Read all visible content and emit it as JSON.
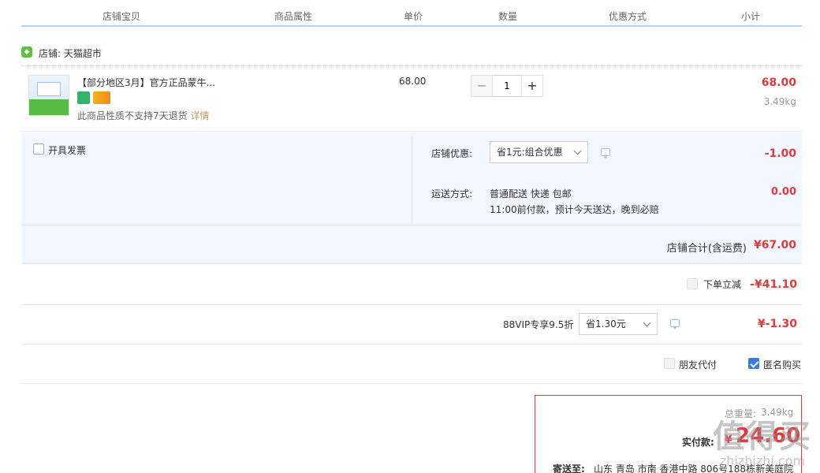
{
  "header": {
    "col_item": "店铺宝贝",
    "col_attr": "商品属性",
    "col_price": "单价",
    "col_qty": "数量",
    "col_discount": "优惠方式",
    "col_subtotal": "小计"
  },
  "shop": {
    "label": "店铺: 天猫超市"
  },
  "item": {
    "title": "【部分地区3月】官方正品蒙牛...",
    "note": "此商品性质不支持7天退货",
    "note_link": "详情",
    "unit_price": "68.00",
    "quantity": "1",
    "subtotal": "68.00",
    "weight": "3.49kg"
  },
  "invoice": {
    "label": "开具发票"
  },
  "shop_discount": {
    "label": "店铺优惠:",
    "selected": "省1元:组合优惠",
    "amount": "-1.00"
  },
  "shipping": {
    "label": "运送方式:",
    "method": "普通配送 快递 包邮",
    "eta": "11:00前付款，预计今天送达，晚到必赔",
    "amount": "0.00"
  },
  "shop_total": {
    "label": "店铺合计(含运费)",
    "amount": "¥67.00"
  },
  "instant_discount": {
    "label": "下单立减",
    "amount": "-¥41.10"
  },
  "vip": {
    "label": "88VIP专享9.5折",
    "selected": "省1.30元",
    "amount": "¥-1.30"
  },
  "options": {
    "friend_pay": "朋友代付",
    "anonymous": "匿名购买"
  },
  "summary": {
    "weight_label": "总重量:",
    "weight_value": "3.49kg",
    "pay_label": "实付款:",
    "currency": "¥",
    "pay_value": "24.60",
    "ship_label": "寄送至:",
    "address": "山东 青岛 市南 香港中路 806号188栋新美庭院"
  },
  "watermark": {
    "logo": "值得买",
    "url": "zhizhizhi.com"
  },
  "colors": {
    "accent_red": "#e4393c",
    "header_line": "#b2d1ff",
    "panel_bg": "#f2f7ff",
    "check_blue": "#3a7be0"
  },
  "icons": {
    "shop": "tmall-shop-icon",
    "message": "message-icon",
    "chevron": "chevron-down-icon"
  }
}
